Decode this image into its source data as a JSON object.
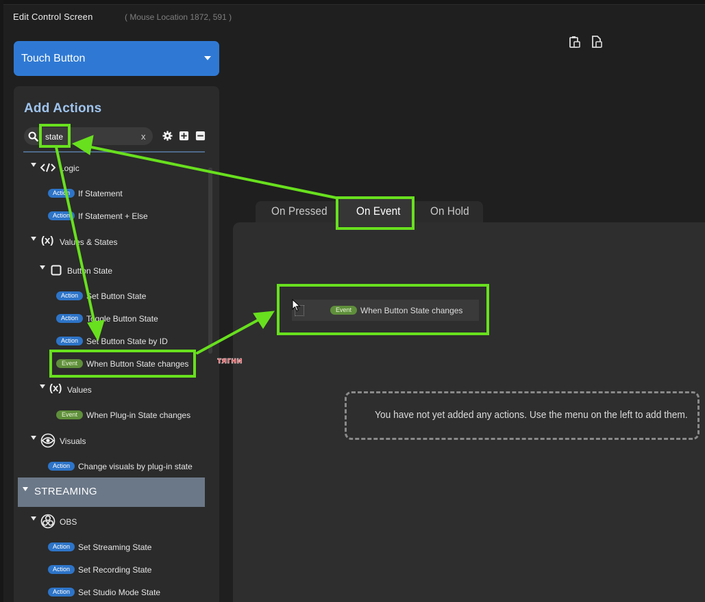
{
  "window": {
    "title": "Edit Control Screen",
    "mouse_location": "( Mouse Location 1872, 591 )"
  },
  "control_type": {
    "selected": "Touch Button"
  },
  "actions_panel": {
    "title": "Add Actions",
    "search": {
      "value": "state",
      "clear_label": "x"
    }
  },
  "tree": {
    "logic": {
      "label": "Logic",
      "items": [
        {
          "badge": "Action",
          "label": "If Statement"
        },
        {
          "badge": "Action",
          "label": "If Statement + Else"
        }
      ]
    },
    "values_states": {
      "label": "Values & States",
      "icon_text": "(x)",
      "button_state": {
        "label": "Button State",
        "items": [
          {
            "badge": "Action",
            "label": "Set Button State"
          },
          {
            "badge": "Action",
            "label": "Toggle Button State"
          },
          {
            "badge": "Action",
            "label": "Set Button State by ID"
          },
          {
            "badge": "Event",
            "label": "When Button State changes"
          }
        ]
      },
      "values": {
        "label": "Values",
        "icon_text": "(x)",
        "items": [
          {
            "badge": "Event",
            "label": "When Plug-in State changes"
          }
        ]
      }
    },
    "visuals": {
      "label": "Visuals",
      "items": [
        {
          "badge": "Action",
          "label": "Change visuals by plug-in state"
        }
      ]
    },
    "streaming": {
      "label": "STREAMING",
      "obs": {
        "label": "OBS",
        "items": [
          {
            "badge": "Action",
            "label": "Set Streaming State"
          },
          {
            "badge": "Action",
            "label": "Set Recording State"
          },
          {
            "badge": "Action",
            "label": "Set Studio Mode State"
          }
        ]
      }
    }
  },
  "tabs": [
    {
      "label": "On Pressed",
      "active": false
    },
    {
      "label": "On Event",
      "active": true
    },
    {
      "label": "On Hold",
      "active": false
    }
  ],
  "dropped_item": {
    "badge": "Event",
    "label": "When Button State changes"
  },
  "empty_message": "You have not yet added any actions. Use the menu on the left to add them.",
  "annotation": {
    "drag_hint": "тягни"
  },
  "colors": {
    "accent_blue": "#2f79d4",
    "highlight_green": "#68e01e",
    "action_badge": "#2d74c8",
    "event_badge": "#5f8f3b",
    "hint_red": "#e8262b"
  },
  "icons": [
    "paste-icon",
    "paste-alt-icon",
    "search-icon",
    "gear-icon",
    "expand-all-icon",
    "collapse-all-icon",
    "code-icon",
    "variable-icon",
    "checkbox-icon",
    "eye-icon",
    "obs-icon",
    "cursor-icon",
    "drag-handle-icon"
  ]
}
